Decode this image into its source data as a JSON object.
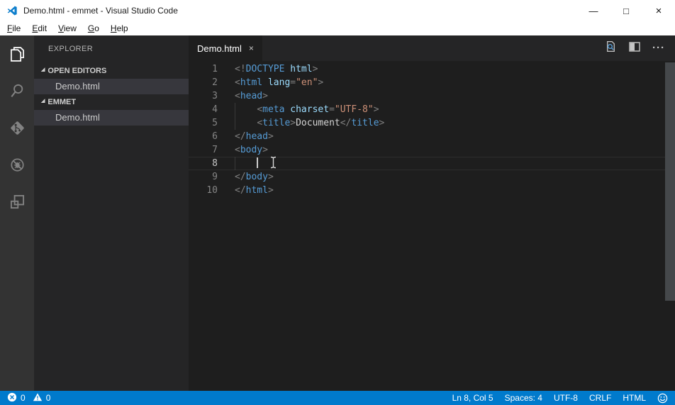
{
  "window": {
    "title": "Demo.html - emmet - Visual Studio Code",
    "controls": {
      "minimize": "—",
      "maximize": "□",
      "close": "×"
    }
  },
  "menu_bar": {
    "items": [
      {
        "label": "File"
      },
      {
        "label": "Edit"
      },
      {
        "label": "View"
      },
      {
        "label": "Go"
      },
      {
        "label": "Help"
      }
    ]
  },
  "activity_bar": {
    "items": [
      {
        "name": "explorer",
        "active": true
      },
      {
        "name": "search",
        "active": false
      },
      {
        "name": "source-control",
        "active": false
      },
      {
        "name": "debug",
        "active": false
      },
      {
        "name": "extensions",
        "active": false
      }
    ]
  },
  "sidebar": {
    "title": "EXPLORER",
    "sections": [
      {
        "label": "OPEN EDITORS",
        "items": [
          {
            "label": "Demo.html",
            "selected": true
          }
        ]
      },
      {
        "label": "EMMET",
        "items": [
          {
            "label": "Demo.html",
            "selected": true
          }
        ]
      }
    ]
  },
  "editor": {
    "tab": {
      "label": "Demo.html",
      "close": "×"
    },
    "actions": [
      {
        "name": "open-preview"
      },
      {
        "name": "split-editor"
      },
      {
        "name": "more-actions"
      }
    ],
    "active_line": 8,
    "cursor": {
      "line": 8,
      "col": 5
    },
    "lines": [
      {
        "num": "1",
        "tokens": [
          [
            "p",
            "<!"
          ],
          [
            "t",
            "DOCTYPE"
          ],
          [
            "a",
            " html"
          ],
          [
            "p",
            ">"
          ]
        ]
      },
      {
        "num": "2",
        "tokens": [
          [
            "p",
            "<"
          ],
          [
            "t",
            "html"
          ],
          [
            "w",
            " "
          ],
          [
            "a",
            "lang"
          ],
          [
            "p",
            "="
          ],
          [
            "s",
            "\"en\""
          ],
          [
            "p",
            ">"
          ]
        ]
      },
      {
        "num": "3",
        "tokens": [
          [
            "p",
            "<"
          ],
          [
            "t",
            "head"
          ],
          [
            "p",
            ">"
          ]
        ]
      },
      {
        "num": "4",
        "indent": 1,
        "tokens": [
          [
            "w",
            "    "
          ],
          [
            "p",
            "<"
          ],
          [
            "t",
            "meta"
          ],
          [
            "w",
            " "
          ],
          [
            "a",
            "charset"
          ],
          [
            "p",
            "="
          ],
          [
            "s",
            "\"UTF-8\""
          ],
          [
            "p",
            ">"
          ]
        ]
      },
      {
        "num": "5",
        "indent": 1,
        "tokens": [
          [
            "w",
            "    "
          ],
          [
            "p",
            "<"
          ],
          [
            "t",
            "title"
          ],
          [
            "p",
            ">"
          ],
          [
            "w",
            "Document"
          ],
          [
            "p",
            "</"
          ],
          [
            "t",
            "title"
          ],
          [
            "p",
            ">"
          ]
        ]
      },
      {
        "num": "6",
        "tokens": [
          [
            "p",
            "</"
          ],
          [
            "t",
            "head"
          ],
          [
            "p",
            ">"
          ]
        ]
      },
      {
        "num": "7",
        "tokens": [
          [
            "p",
            "<"
          ],
          [
            "t",
            "body"
          ],
          [
            "p",
            ">"
          ]
        ]
      },
      {
        "num": "8",
        "indent": 1,
        "tokens": [
          [
            "w",
            "    "
          ]
        ]
      },
      {
        "num": "9",
        "tokens": [
          [
            "p",
            "</"
          ],
          [
            "t",
            "body"
          ],
          [
            "p",
            ">"
          ]
        ]
      },
      {
        "num": "10",
        "tokens": [
          [
            "p",
            "</"
          ],
          [
            "t",
            "html"
          ],
          [
            "p",
            ">"
          ]
        ]
      }
    ]
  },
  "status_bar": {
    "errors": "0",
    "warnings": "0",
    "right": [
      {
        "label": "Ln 8, Col 5"
      },
      {
        "label": "Spaces: 4"
      },
      {
        "label": "UTF-8"
      },
      {
        "label": "CRLF"
      },
      {
        "label": "HTML"
      }
    ]
  },
  "colors": {
    "accent": "#007acc",
    "titlebar_bg": "#ffffff",
    "activity_bar_bg": "#333333",
    "sidebar_bg": "#252526",
    "editor_bg": "#1e1e1e",
    "selection_bg": "#37373d",
    "tag": "#569cd6",
    "attribute": "#9cdcfe",
    "string": "#ce9178",
    "punctuation": "#808080",
    "text": "#d4d4d4",
    "line_number": "#858585"
  }
}
